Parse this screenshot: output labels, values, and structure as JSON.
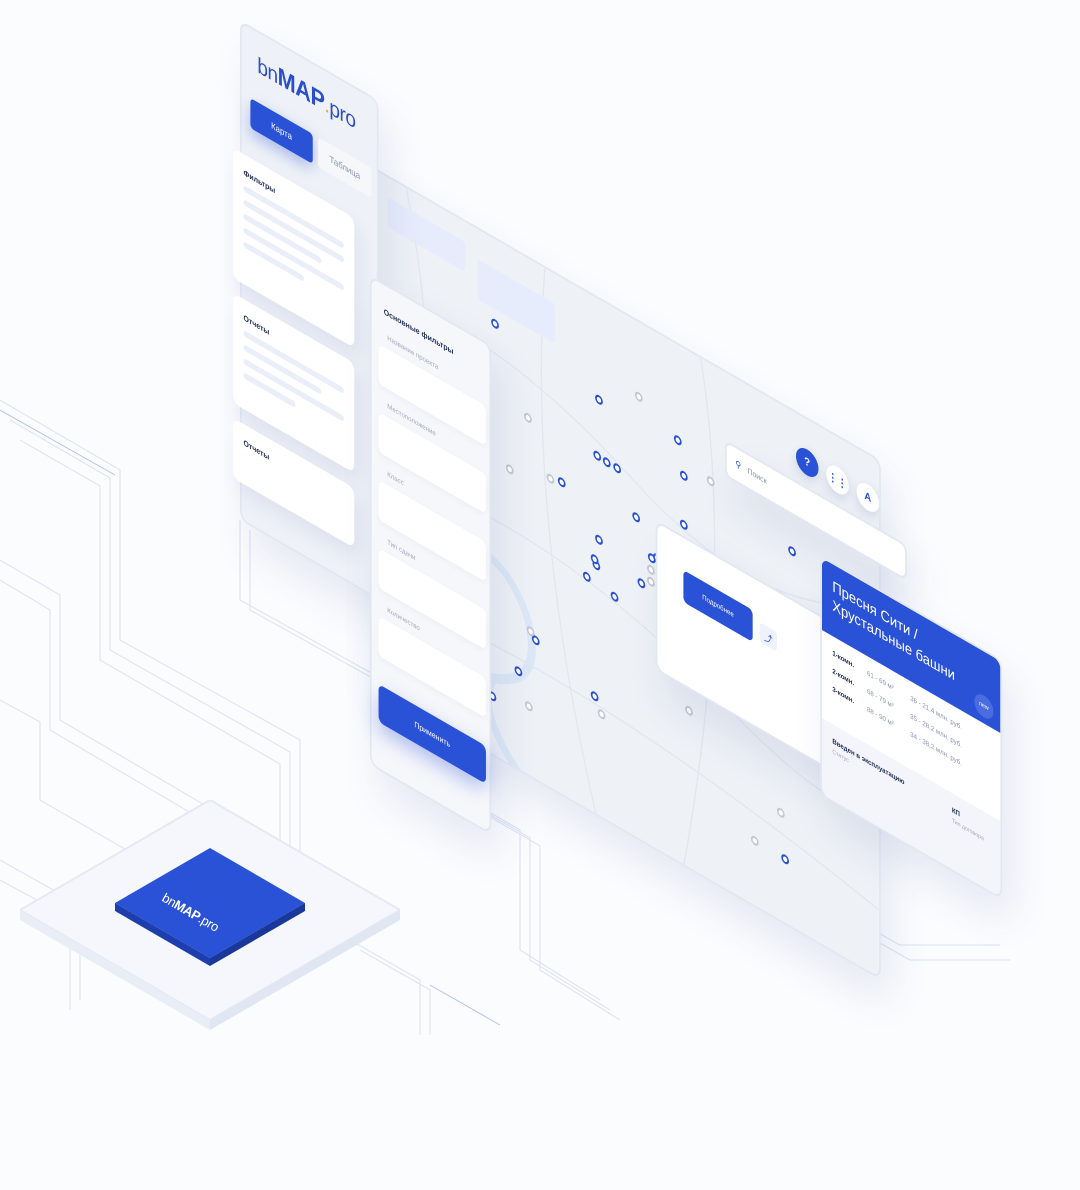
{
  "brand": {
    "logo_prefix": "bn",
    "logo_main": "MAP",
    "logo_suffix": "pro"
  },
  "sidebar": {
    "tabs": [
      {
        "label": "Карта",
        "active": true
      },
      {
        "label": "Таблица",
        "active": false
      }
    ],
    "cards": [
      {
        "title": "Фильтры"
      },
      {
        "title": "Отчеты"
      },
      {
        "title": "Отчеты"
      }
    ]
  },
  "filters": {
    "header": "Основные фильтры",
    "fields": [
      {
        "placeholder": "Название проекта"
      },
      {
        "placeholder": "Местоположение"
      },
      {
        "placeholder": "Класс"
      },
      {
        "placeholder": "Тип сдачи"
      },
      {
        "placeholder": "Количество"
      }
    ],
    "apply_label": "Применить"
  },
  "map": {
    "controls": [
      {
        "icon": "help-icon",
        "glyph": "?"
      },
      {
        "icon": "grid-icon",
        "glyph": "⋮⋮"
      },
      {
        "icon": "user-icon",
        "glyph": "A"
      }
    ],
    "search_placeholder": "Поиск",
    "markers_active_count": 34,
    "markers_inactive_count": 16
  },
  "detail": {
    "more_label": "Подробнее",
    "share_icon": "share-icon"
  },
  "property": {
    "title_line1": "Пресня Сити /",
    "title_line2": "Хрустальные башни",
    "badge": "new",
    "rows": [
      {
        "rooms": "1-комн.",
        "area": "61 - 69 м²",
        "price": "36 - 21,4 млн. руб."
      },
      {
        "rooms": "2-комн.",
        "area": "68 - 79 м²",
        "price": "35 - 28,2 млн. руб."
      },
      {
        "rooms": "3-комн.",
        "area": "88 - 90 м²",
        "price": "34 - 38,2 млн. руб."
      }
    ],
    "footer_left_title": "Введен в эксплуатацию",
    "footer_left_sub": "Статус",
    "footer_right_title": "КП",
    "footer_right_sub": "Тип договора"
  },
  "colors": {
    "accent": "#2a52d6",
    "background": "#fbfcfe",
    "panel": "#f2f4f9",
    "marker_inactive": "#c4c8d2",
    "logo_dot": "#f2a51f"
  }
}
